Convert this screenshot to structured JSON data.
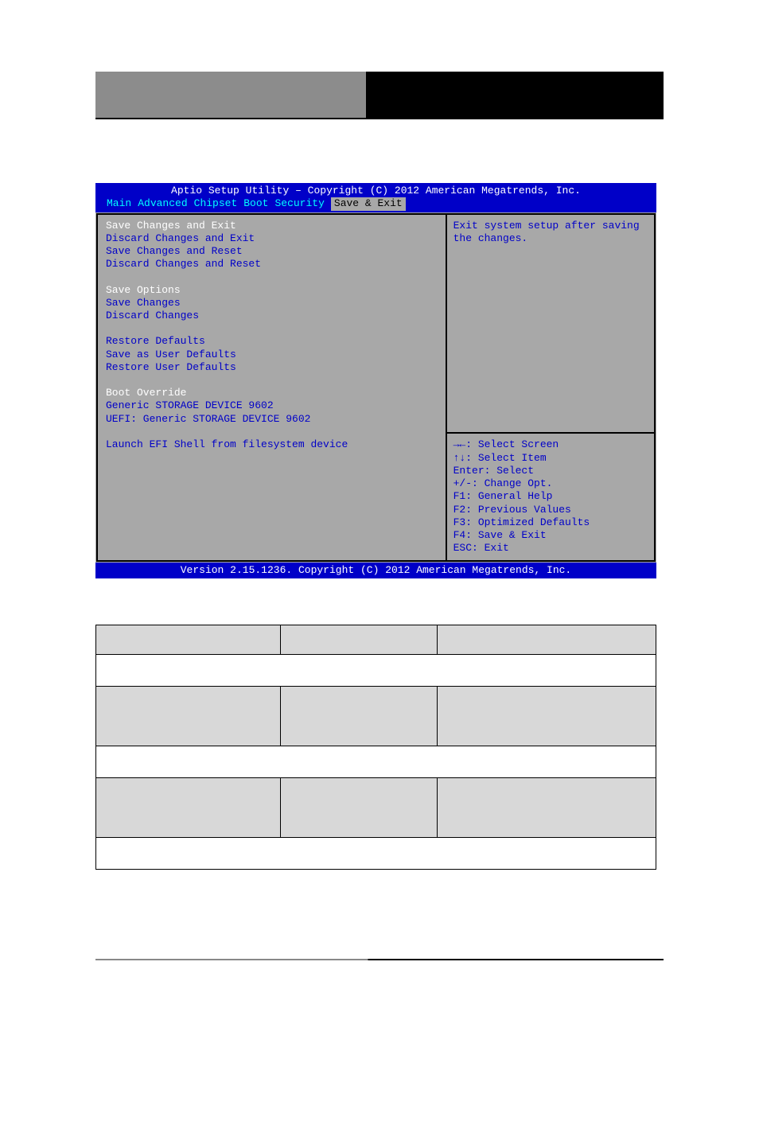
{
  "header": {
    "left": "",
    "right": ""
  },
  "bios": {
    "title": "Aptio Setup Utility – Copyright (C) 2012 American Megatrends, Inc.",
    "tabs": [
      "Main",
      "Advanced",
      "Chipset",
      "Boot",
      "Security",
      "Save & Exit"
    ],
    "active_tab": "Save & Exit",
    "items": [
      {
        "label": "Save Changes and Exit",
        "selected": true
      },
      {
        "label": "Discard Changes and Exit"
      },
      {
        "label": "Save Changes and Reset"
      },
      {
        "label": "Discard Changes and Reset"
      },
      {
        "spacer": true
      },
      {
        "label": "Save Options",
        "section": true
      },
      {
        "label": "Save Changes"
      },
      {
        "label": "Discard Changes"
      },
      {
        "spacer": true
      },
      {
        "label": "Restore Defaults"
      },
      {
        "label": "Save as User Defaults"
      },
      {
        "label": "Restore User Defaults"
      },
      {
        "spacer": true
      },
      {
        "label": "Boot Override",
        "section": true
      },
      {
        "label": "Generic STORAGE DEVICE 9602"
      },
      {
        "label": "UEFI: Generic STORAGE DEVICE 9602"
      },
      {
        "spacer": true
      },
      {
        "label": "Launch EFI Shell from filesystem device"
      }
    ],
    "help_top": "Exit system setup after saving the changes.",
    "help_keys": [
      "→←: Select Screen",
      "↑↓: Select Item",
      "Enter: Select",
      "+/-: Change Opt.",
      "F1: General Help",
      "F2: Previous Values",
      "F3: Optimized Defaults",
      "F4: Save & Exit",
      "ESC: Exit"
    ],
    "footer": "Version 2.15.1236. Copyright (C) 2012 American Megatrends, Inc."
  },
  "table": {
    "r1": {
      "c1": "",
      "c2": "",
      "c3": ""
    },
    "r2": "",
    "r3": {
      "c1": "",
      "c2": "",
      "c3": ""
    },
    "r4": "",
    "r5": {
      "c1": "",
      "c2": "",
      "c3": ""
    },
    "r6": ""
  }
}
